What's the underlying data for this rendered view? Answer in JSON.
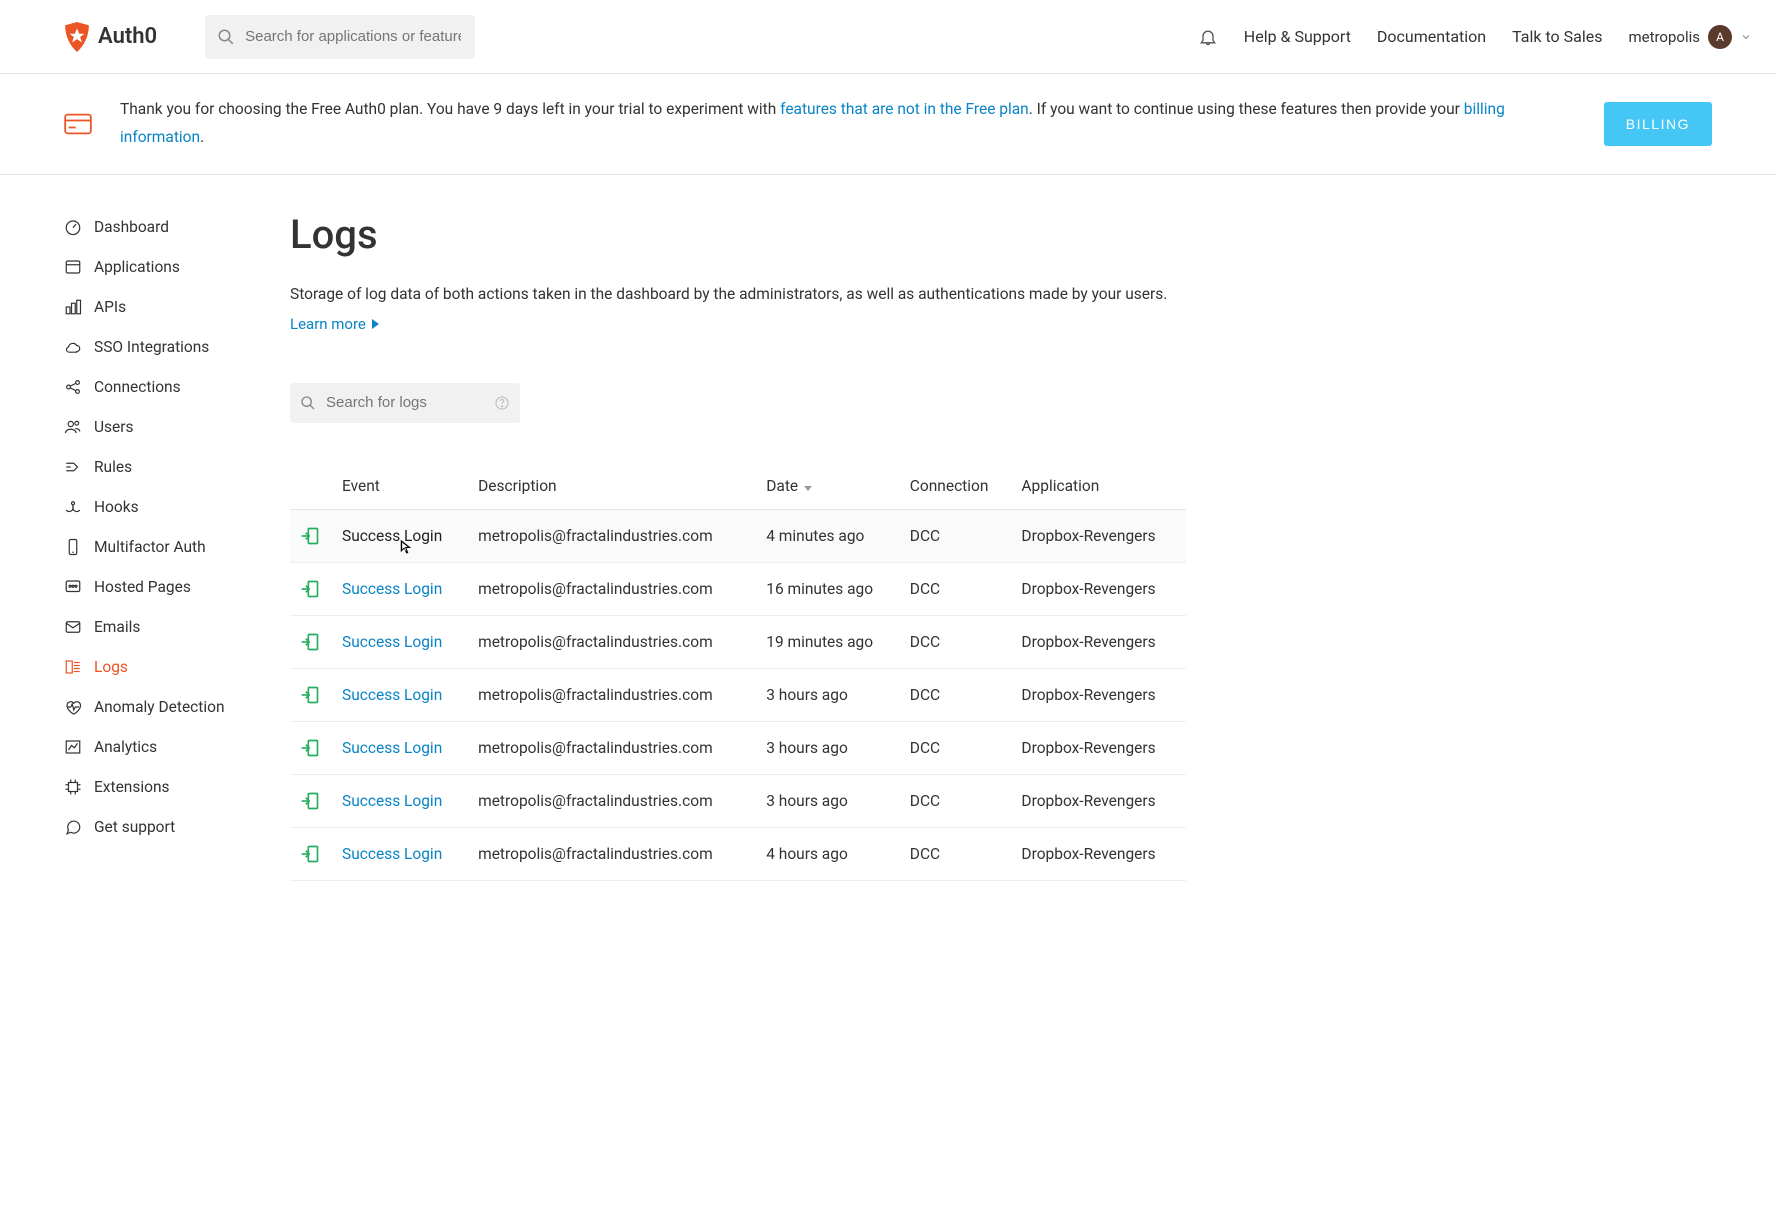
{
  "brand": {
    "name": "Auth0"
  },
  "topbar": {
    "search_placeholder": "Search for applications or features",
    "nav": {
      "help": "Help & Support",
      "docs": "Documentation",
      "sales": "Talk to Sales"
    },
    "tenant_name": "metropolis",
    "avatar_initial": "A"
  },
  "banner": {
    "text_before_link1": "Thank you for choosing the Free Auth0 plan. You have 9 days left in your trial to experiment with ",
    "link1": "features that are not in the Free plan",
    "text_between": ". If you want to continue using these features then provide your ",
    "link2": "billing information",
    "text_after": ".",
    "button": "BILLING"
  },
  "sidebar": {
    "items": [
      {
        "label": "Dashboard"
      },
      {
        "label": "Applications"
      },
      {
        "label": "APIs"
      },
      {
        "label": "SSO Integrations"
      },
      {
        "label": "Connections"
      },
      {
        "label": "Users"
      },
      {
        "label": "Rules"
      },
      {
        "label": "Hooks"
      },
      {
        "label": "Multifactor Auth"
      },
      {
        "label": "Hosted Pages"
      },
      {
        "label": "Emails"
      },
      {
        "label": "Logs"
      },
      {
        "label": "Anomaly Detection"
      },
      {
        "label": "Analytics"
      },
      {
        "label": "Extensions"
      },
      {
        "label": "Get support"
      }
    ]
  },
  "page": {
    "title": "Logs",
    "description": "Storage of log data of both actions taken in the dashboard by the administrators, as well as authentications made by your users.",
    "learn_more": "Learn more",
    "log_search_placeholder": "Search for logs"
  },
  "table": {
    "headers": {
      "event": "Event",
      "description": "Description",
      "date": "Date",
      "connection": "Connection",
      "application": "Application"
    },
    "rows": [
      {
        "event": "Success Login",
        "description": "metropolis@fractalindustries.com",
        "date": "4 minutes ago",
        "connection": "DCC",
        "application": "Dropbox-Revengers"
      },
      {
        "event": "Success Login",
        "description": "metropolis@fractalindustries.com",
        "date": "16 minutes ago",
        "connection": "DCC",
        "application": "Dropbox-Revengers"
      },
      {
        "event": "Success Login",
        "description": "metropolis@fractalindustries.com",
        "date": "19 minutes ago",
        "connection": "DCC",
        "application": "Dropbox-Revengers"
      },
      {
        "event": "Success Login",
        "description": "metropolis@fractalindustries.com",
        "date": "3 hours ago",
        "connection": "DCC",
        "application": "Dropbox-Revengers"
      },
      {
        "event": "Success Login",
        "description": "metropolis@fractalindustries.com",
        "date": "3 hours ago",
        "connection": "DCC",
        "application": "Dropbox-Revengers"
      },
      {
        "event": "Success Login",
        "description": "metropolis@fractalindustries.com",
        "date": "3 hours ago",
        "connection": "DCC",
        "application": "Dropbox-Revengers"
      },
      {
        "event": "Success Login",
        "description": "metropolis@fractalindustries.com",
        "date": "4 hours ago",
        "connection": "DCC",
        "application": "Dropbox-Revengers"
      }
    ]
  }
}
